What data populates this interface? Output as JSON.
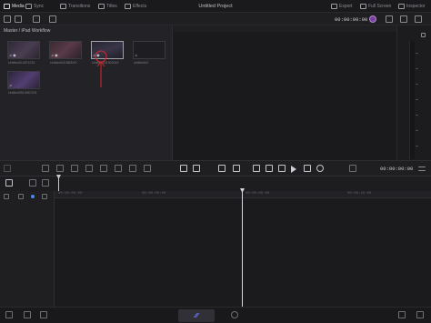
{
  "topbar": {
    "media_label": "Media",
    "sync_label": "Sync",
    "transitions_label": "Transitions",
    "titles_label": "Titles",
    "effects_label": "Effects",
    "project_title": "Untitled Project",
    "export_label": "Export",
    "fullscreen_label": "Full Screen",
    "inspector_label": "Inspector"
  },
  "viewer": {
    "timecode_top": "00:00:00:00",
    "timecode_transport": "00:00:00:00"
  },
  "mediapool": {
    "title": "Master / iPad Workflow",
    "clips": [
      {
        "name": "Untitled014571031"
      },
      {
        "name": "Untitled021880020"
      },
      {
        "name": "Untitled031902049"
      },
      {
        "name": "Untitled04"
      },
      {
        "name": "Untitled0514967203"
      }
    ]
  },
  "timeline": {
    "ruler_labels": [
      "00:00:00:00",
      "00:00:08:00",
      "00:00:16:00"
    ]
  },
  "colors": {
    "accent": "#5b6cff",
    "annotation": "#d8262c",
    "background": "#1c1c1f"
  }
}
